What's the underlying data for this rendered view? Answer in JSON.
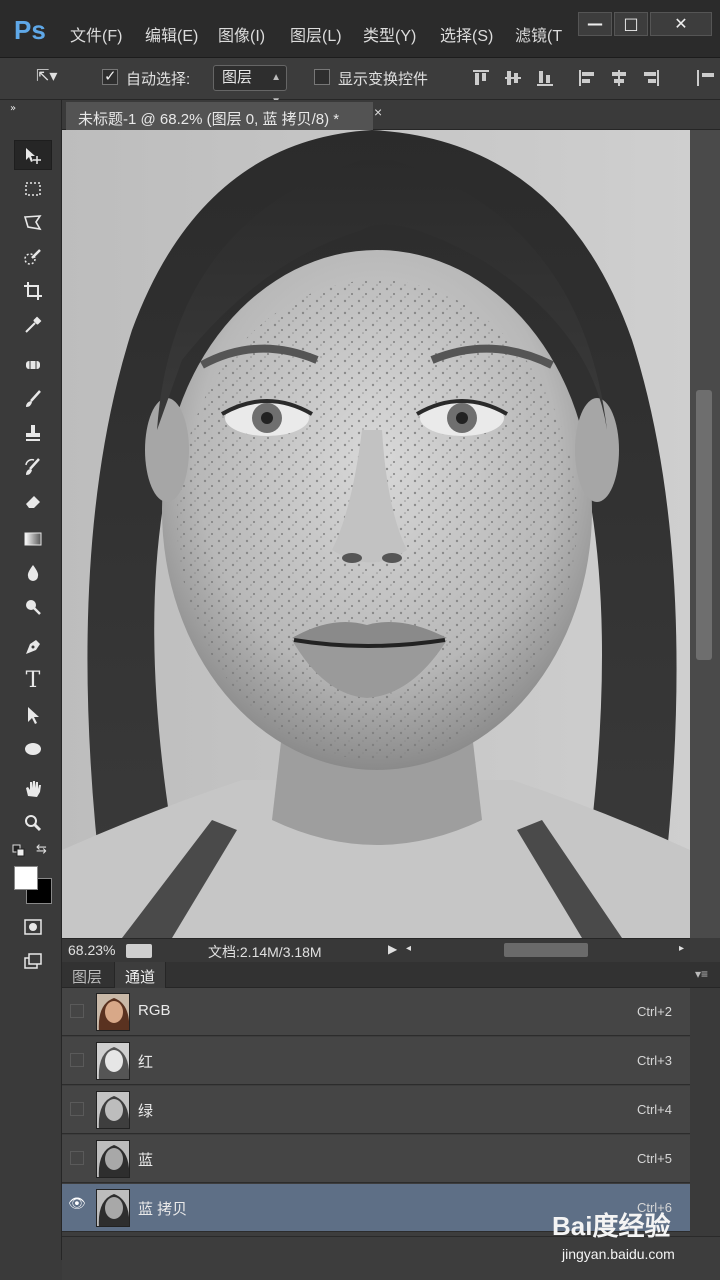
{
  "app": {
    "logo": "Ps"
  },
  "menu": [
    "文件(F)",
    "编辑(E)",
    "图像(I)",
    "图层(L)",
    "类型(Y)",
    "选择(S)",
    "滤镜(T"
  ],
  "window_controls": {
    "minimize": "—",
    "maximize": "□",
    "close": "✕"
  },
  "options_bar": {
    "auto_select_label": "自动选择:",
    "auto_select_checked": true,
    "auto_select_target": "图层",
    "show_transform_label": "显示变换控件",
    "show_transform_checked": false
  },
  "document": {
    "tab_label": "未标题-1 @ 68.2% (图层 0, 蓝 拷贝/8) *",
    "close": "×"
  },
  "status": {
    "zoom": "68.23%",
    "doc_info": "文档:2.14M/3.18M"
  },
  "panel": {
    "tabs": [
      "图层",
      "通道"
    ],
    "active_tab": "通道",
    "channels": [
      {
        "name": "RGB",
        "shortcut": "Ctrl+2",
        "visible": false,
        "selected": false
      },
      {
        "name": "红",
        "shortcut": "Ctrl+3",
        "visible": false,
        "selected": false
      },
      {
        "name": "绿",
        "shortcut": "Ctrl+4",
        "visible": false,
        "selected": false
      },
      {
        "name": "蓝",
        "shortcut": "Ctrl+5",
        "visible": false,
        "selected": false
      },
      {
        "name": "蓝 拷贝",
        "shortcut": "Ctrl+6",
        "visible": true,
        "selected": true
      }
    ]
  },
  "watermark": {
    "logo": "Bai度经验",
    "url": "jingyan.baidu.com"
  },
  "colors": {
    "selection": "#5e6f86",
    "ps_blue": "#5fa8e8"
  }
}
